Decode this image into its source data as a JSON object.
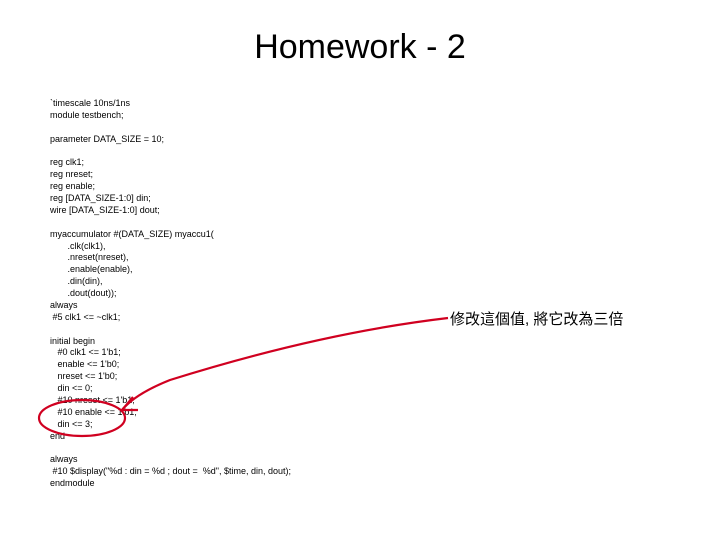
{
  "title": "Homework - 2",
  "code": "`timescale 10ns/1ns\nmodule testbench;\n\nparameter DATA_SIZE = 10;\n\nreg clk1;\nreg nreset;\nreg enable;\nreg [DATA_SIZE-1:0] din;\nwire [DATA_SIZE-1:0] dout;\n\nmyaccumulator #(DATA_SIZE) myaccu1(\n       .clk(clk1),\n       .nreset(nreset),\n       .enable(enable),\n       .din(din),\n       .dout(dout));\nalways\n #5 clk1 <= ~clk1;\n\ninitial begin\n   #0 clk1 <= 1'b1;\n   enable <= 1'b0;\n   nreset <= 1'b0;\n   din <= 0;\n   #10 nreset <= 1'b1;\n   #10 enable <= 1'b1;\n   din <= 3;\nend\n\nalways\n #10 $display(\"%d : din = %d ; dout =  %d\", $time, din, dout);\nendmodule",
  "annotation": "修改這個值, 將它改為三倍"
}
